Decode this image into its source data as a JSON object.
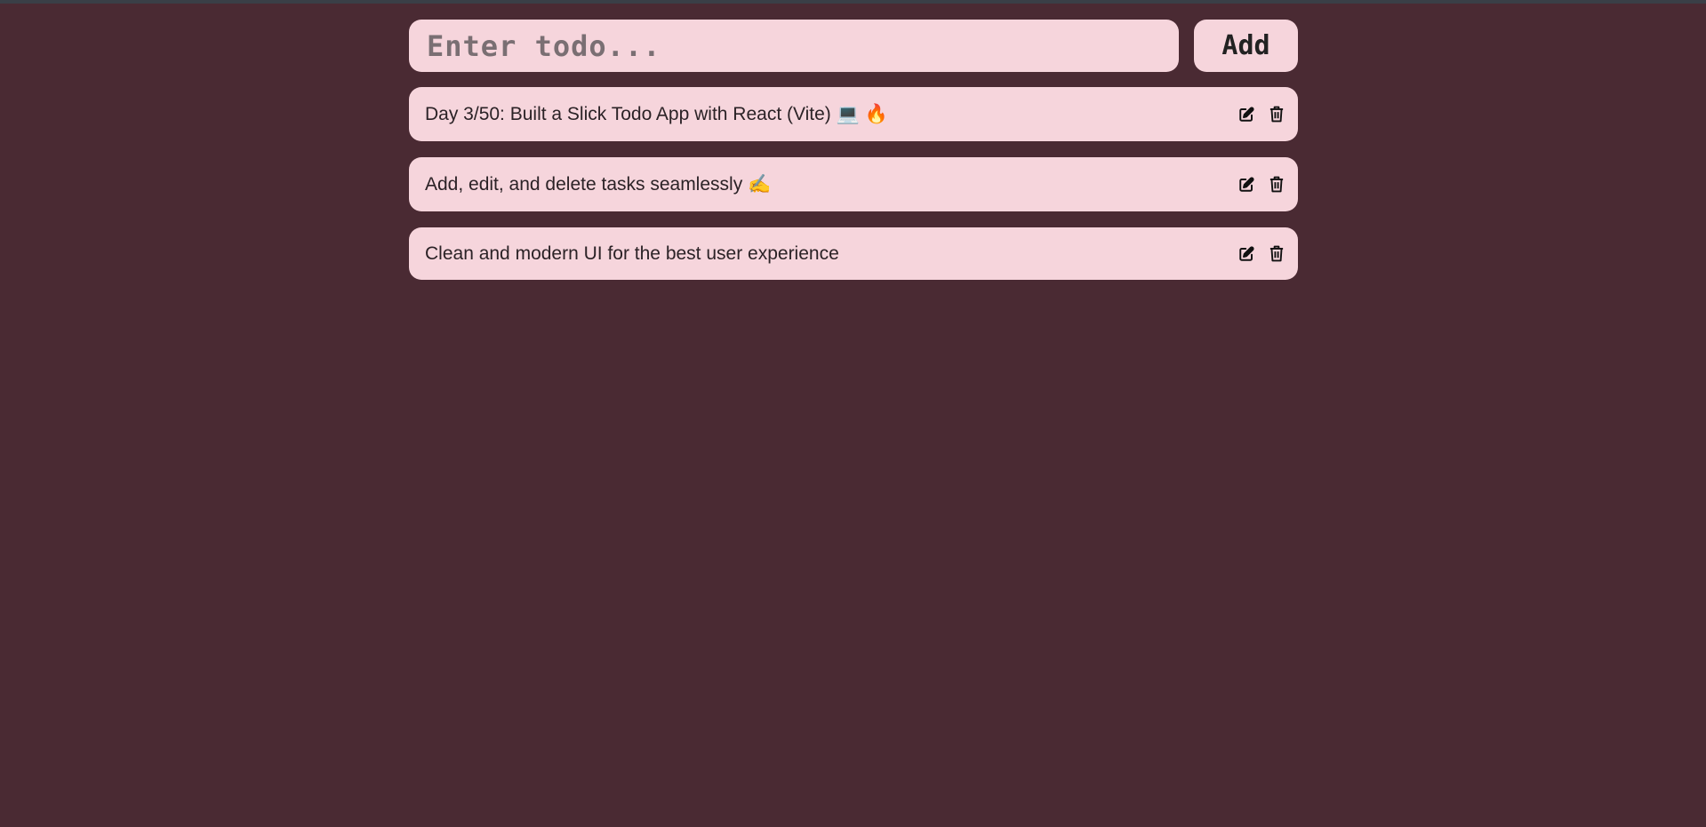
{
  "input": {
    "placeholder": "Enter todo...",
    "value": ""
  },
  "add_button": {
    "label": "Add"
  },
  "todos": [
    {
      "text": "Day 3/50: Built a Slick Todo App with React (Vite) 💻 🔥",
      "edit_icon": "edit-icon",
      "delete_icon": "trash-icon"
    },
    {
      "text": "Add, edit, and delete tasks seamlessly ✍️",
      "edit_icon": "edit-icon",
      "delete_icon": "trash-icon"
    },
    {
      "text": "Clean and modern UI for the best user experience",
      "edit_icon": "edit-icon",
      "delete_icon": "trash-icon"
    }
  ],
  "colors": {
    "background": "#4a2a33",
    "card": "#f6d5dc",
    "text": "#2b2226"
  }
}
